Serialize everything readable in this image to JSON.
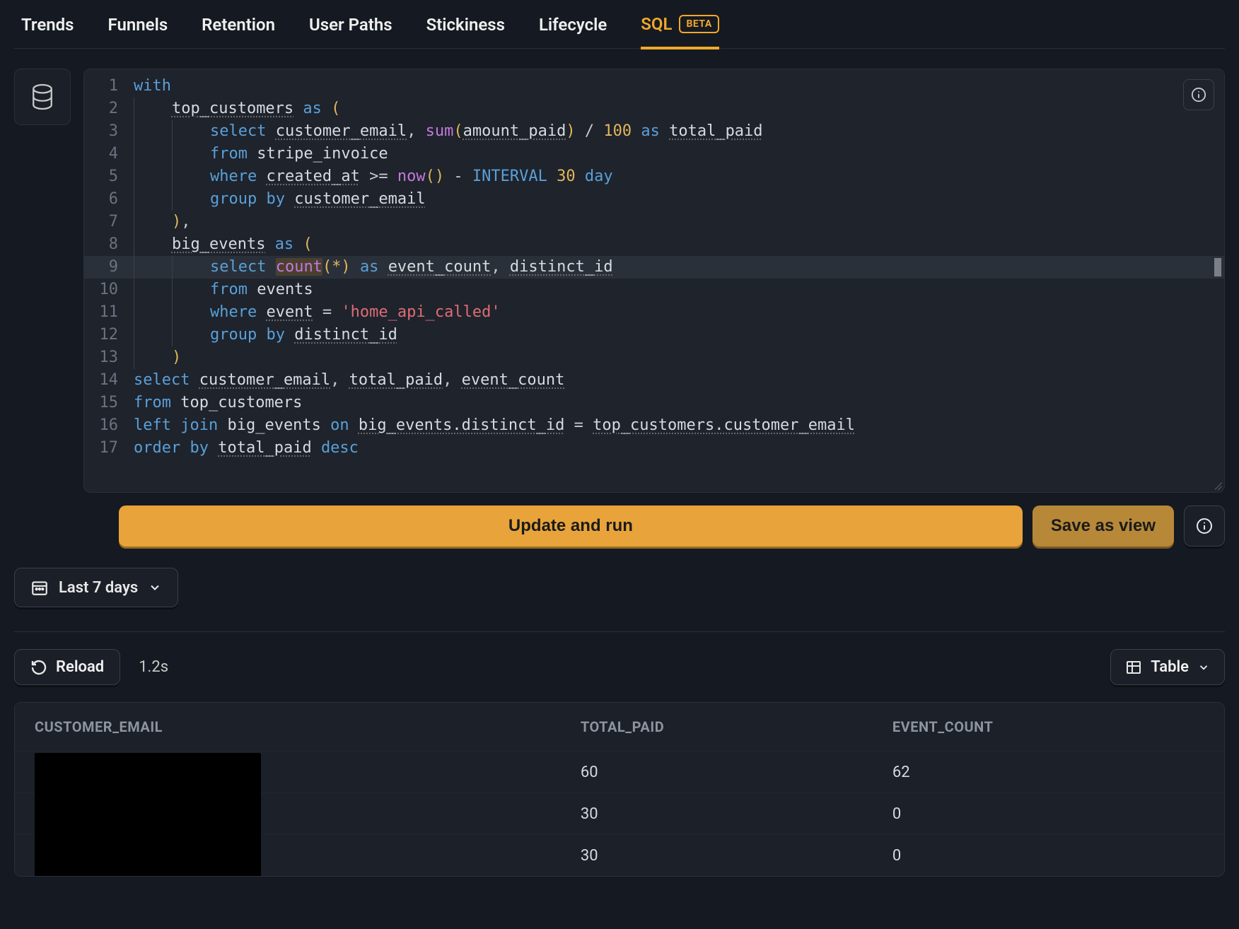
{
  "tabs": [
    {
      "label": "Trends"
    },
    {
      "label": "Funnels"
    },
    {
      "label": "Retention"
    },
    {
      "label": "User Paths"
    },
    {
      "label": "Stickiness"
    },
    {
      "label": "Lifecycle"
    },
    {
      "label": "SQL",
      "badge": "BETA",
      "active": true
    }
  ],
  "editor": {
    "highlighted_line": 9,
    "lines": [
      [
        [
          "kw",
          "with"
        ]
      ],
      [
        [
          "sp",
          "    "
        ],
        [
          "id-u",
          "top_customers"
        ],
        [
          "op",
          " "
        ],
        [
          "kw",
          "as"
        ],
        [
          "op",
          " "
        ],
        [
          "pn",
          "("
        ]
      ],
      [
        [
          "sp",
          "        "
        ],
        [
          "kw",
          "select"
        ],
        [
          "op",
          " "
        ],
        [
          "id-u",
          "customer_email"
        ],
        [
          "op",
          ", "
        ],
        [
          "fn",
          "sum"
        ],
        [
          "pn",
          "("
        ],
        [
          "id-u",
          "amount_paid"
        ],
        [
          "pn",
          ")"
        ],
        [
          "op",
          " / "
        ],
        [
          "num",
          "100"
        ],
        [
          "op",
          " "
        ],
        [
          "kw",
          "as"
        ],
        [
          "op",
          " "
        ],
        [
          "id-u",
          "total_paid"
        ]
      ],
      [
        [
          "sp",
          "        "
        ],
        [
          "kw",
          "from"
        ],
        [
          "op",
          " "
        ],
        [
          "id",
          "stripe_invoice"
        ]
      ],
      [
        [
          "sp",
          "        "
        ],
        [
          "kw",
          "where"
        ],
        [
          "op",
          " "
        ],
        [
          "id-u",
          "created_at"
        ],
        [
          "op",
          " >= "
        ],
        [
          "fn",
          "now"
        ],
        [
          "pn",
          "()"
        ],
        [
          "op",
          " - "
        ],
        [
          "kw2",
          "INTERVAL"
        ],
        [
          "op",
          " "
        ],
        [
          "num",
          "30"
        ],
        [
          "op",
          " "
        ],
        [
          "kw2",
          "day"
        ]
      ],
      [
        [
          "sp",
          "        "
        ],
        [
          "kw",
          "group"
        ],
        [
          "op",
          " "
        ],
        [
          "kw",
          "by"
        ],
        [
          "op",
          " "
        ],
        [
          "id-u",
          "customer_email"
        ]
      ],
      [
        [
          "sp",
          "    "
        ],
        [
          "pn",
          ")"
        ],
        [
          "op",
          ","
        ]
      ],
      [
        [
          "sp",
          "    "
        ],
        [
          "id-u",
          "big_events"
        ],
        [
          "op",
          " "
        ],
        [
          "kw",
          "as"
        ],
        [
          "op",
          " "
        ],
        [
          "pn",
          "("
        ]
      ],
      [
        [
          "sp",
          "        "
        ],
        [
          "kw",
          "select"
        ],
        [
          "op",
          " "
        ],
        [
          "fnhl",
          "count"
        ],
        [
          "pn",
          "(*)"
        ],
        [
          "op",
          " "
        ],
        [
          "kw",
          "as"
        ],
        [
          "op",
          " "
        ],
        [
          "id-u",
          "event_count"
        ],
        [
          "op",
          ", "
        ],
        [
          "id-u",
          "distinct_id"
        ]
      ],
      [
        [
          "sp",
          "        "
        ],
        [
          "kw",
          "from"
        ],
        [
          "op",
          " "
        ],
        [
          "id",
          "events"
        ]
      ],
      [
        [
          "sp",
          "        "
        ],
        [
          "kw",
          "where"
        ],
        [
          "op",
          " "
        ],
        [
          "id-u",
          "event"
        ],
        [
          "op",
          " = "
        ],
        [
          "str",
          "'home_api_called'"
        ]
      ],
      [
        [
          "sp",
          "        "
        ],
        [
          "kw",
          "group"
        ],
        [
          "op",
          " "
        ],
        [
          "kw",
          "by"
        ],
        [
          "op",
          " "
        ],
        [
          "id-u",
          "distinct_id"
        ]
      ],
      [
        [
          "sp",
          "    "
        ],
        [
          "pn",
          ")"
        ]
      ],
      [
        [
          "kw",
          "select"
        ],
        [
          "op",
          " "
        ],
        [
          "id-u",
          "customer_email"
        ],
        [
          "op",
          ", "
        ],
        [
          "id-u",
          "total_paid"
        ],
        [
          "op",
          ", "
        ],
        [
          "id-u",
          "event_count"
        ]
      ],
      [
        [
          "kw",
          "from"
        ],
        [
          "op",
          " "
        ],
        [
          "id",
          "top_customers"
        ]
      ],
      [
        [
          "kw",
          "left"
        ],
        [
          "op",
          " "
        ],
        [
          "kw",
          "join"
        ],
        [
          "op",
          " "
        ],
        [
          "id",
          "big_events"
        ],
        [
          "op",
          " "
        ],
        [
          "kw",
          "on"
        ],
        [
          "op",
          " "
        ],
        [
          "id-u",
          "big_events.distinct_id"
        ],
        [
          "op",
          " = "
        ],
        [
          "id-u",
          "top_customers.customer_email"
        ]
      ],
      [
        [
          "kw",
          "order"
        ],
        [
          "op",
          " "
        ],
        [
          "kw",
          "by"
        ],
        [
          "op",
          " "
        ],
        [
          "id-u",
          "total_paid"
        ],
        [
          "op",
          " "
        ],
        [
          "kw",
          "desc"
        ]
      ]
    ]
  },
  "buttons": {
    "run": "Update and run",
    "save": "Save as view"
  },
  "daterange": {
    "label": "Last 7 days"
  },
  "toolbar": {
    "reload": "Reload",
    "timing": "1.2s",
    "view": "Table"
  },
  "results": {
    "columns": [
      "CUSTOMER_EMAIL",
      "TOTAL_PAID",
      "EVENT_COUNT"
    ],
    "rows": [
      {
        "customer_email": "",
        "total_paid": "60",
        "event_count": "62"
      },
      {
        "customer_email": "",
        "total_paid": "30",
        "event_count": "0"
      },
      {
        "customer_email": "",
        "total_paid": "30",
        "event_count": "0"
      }
    ]
  }
}
